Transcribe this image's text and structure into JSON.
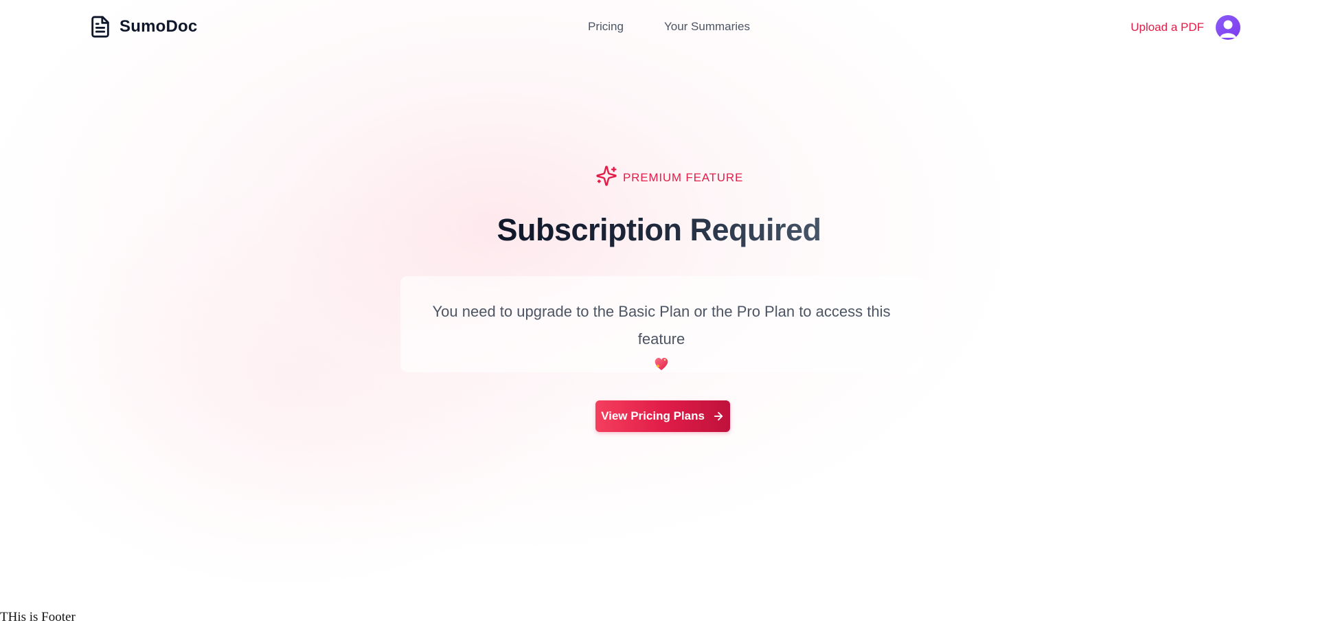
{
  "header": {
    "logo_text": "SumoDoc",
    "logo_icon": "file-text-icon",
    "nav": [
      {
        "label": "Pricing"
      },
      {
        "label": "Your Summaries"
      }
    ],
    "upload_label": "Upload a PDF",
    "avatar_icon": "user-avatar-icon"
  },
  "main": {
    "badge_icon": "sparkles-icon",
    "badge_text": "Premium Feature",
    "title": "Subscription Required",
    "message": "You need to upgrade to the Basic Plan or the Pro Plan to access this feature",
    "message_emoji_icon": "sparkling-heart-icon",
    "cta_label": "View Pricing Plans",
    "cta_icon": "arrow-right-icon"
  },
  "footer": {
    "text": "THis is Footer"
  },
  "colors": {
    "accent": "#e11d48",
    "text_dark": "#0f172a",
    "text_muted": "#4b5563",
    "avatar": "#8b5cf6"
  }
}
